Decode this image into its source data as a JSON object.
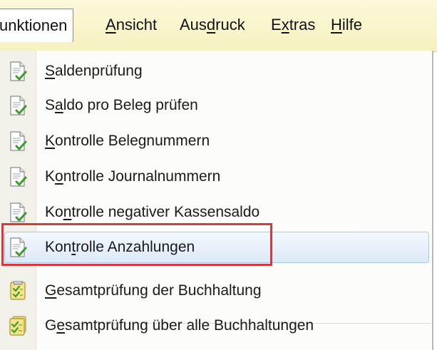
{
  "menubar": {
    "items": [
      {
        "pre": "",
        "ul": "F",
        "post": "unktionen",
        "display": "Funktionen"
      },
      {
        "pre": "",
        "ul": "A",
        "post": "nsicht"
      },
      {
        "pre": "Aus",
        "ul": "d",
        "post": "ruck"
      },
      {
        "pre": "E",
        "ul": "x",
        "post": "tras"
      },
      {
        "pre": "",
        "ul": "H",
        "post": "ilfe"
      }
    ],
    "active_visible_text": "unktionen"
  },
  "dropdown": {
    "items": [
      {
        "pre": "",
        "ul": "S",
        "post": "aldenprüfung",
        "icon": "document-check-icon"
      },
      {
        "pre": "S",
        "ul": "a",
        "post": "ldo pro Beleg prüfen",
        "icon": "document-check-icon"
      },
      {
        "pre": "",
        "ul": "K",
        "post": "ontrolle Belegnummern",
        "icon": "document-check-icon"
      },
      {
        "pre": "K",
        "ul": "o",
        "post": "ntrolle Journalnummern",
        "icon": "document-check-icon"
      },
      {
        "pre": "Ko",
        "ul": "n",
        "post": "trolle negativer Kassensaldo",
        "icon": "document-check-icon"
      },
      {
        "pre": "Kon",
        "ul": "t",
        "post": "rolle Anzahlungen",
        "icon": "document-check-icon",
        "highlighted": true
      },
      {
        "pre": "",
        "ul": "G",
        "post": "esamtprüfung der Buchhaltung",
        "icon": "checklist-icon"
      },
      {
        "pre": "G",
        "ul": "e",
        "post": "samtprüfung über alle Buchhaltungen",
        "icon": "checklist-stack-icon"
      }
    ]
  },
  "colors": {
    "menubar_bg": "#f6f1bf",
    "highlight_border": "#a8c5e8",
    "annotation_red": "#d33a3a"
  }
}
